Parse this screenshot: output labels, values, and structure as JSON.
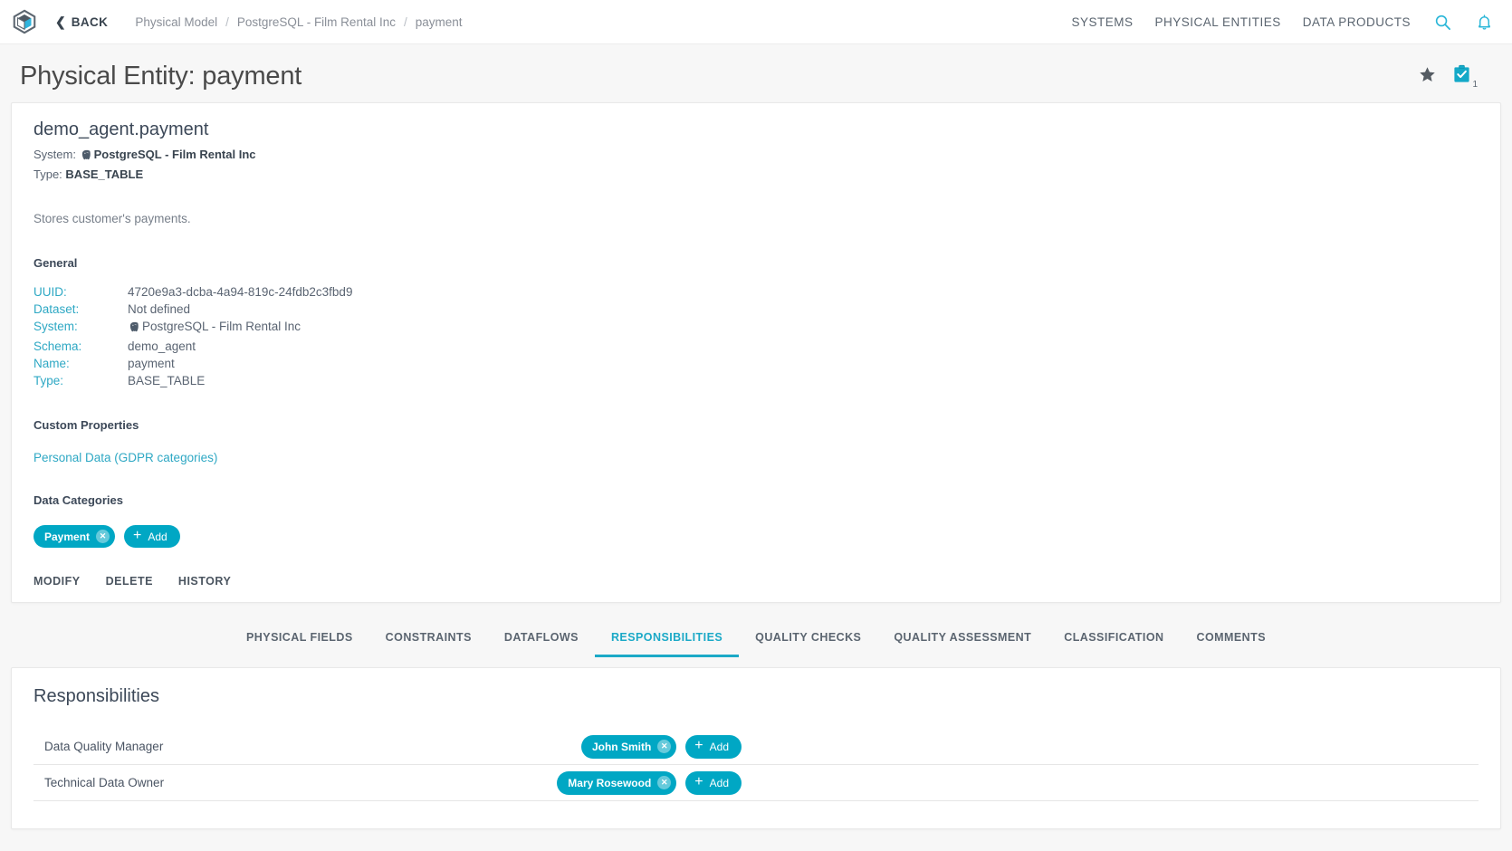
{
  "topbar": {
    "logo_icon": "cube-logo-icon",
    "back_label": "BACK",
    "back_chevron_icon": "chevron-left-icon",
    "breadcrumb": [
      {
        "label": "Physical Model",
        "last": false
      },
      {
        "label": "PostgreSQL - Film Rental Inc",
        "last": false
      },
      {
        "label": "payment",
        "last": true
      }
    ],
    "breadcrumb_separator": "/",
    "nav": [
      {
        "label": "SYSTEMS"
      },
      {
        "label": "PHYSICAL ENTITIES"
      },
      {
        "label": "DATA PRODUCTS"
      }
    ],
    "search_icon": "search-icon",
    "notifications_icon": "bell-icon"
  },
  "page": {
    "title": "Physical Entity: payment",
    "favorite_icon": "star-icon",
    "task_icon": "clipboard-check-icon",
    "task_count": "1"
  },
  "entity": {
    "name": "demo_agent.payment",
    "system_label": "System:",
    "system_value": "PostgreSQL - Film Rental Inc",
    "system_icon": "postgresql-elephant-icon",
    "type_label": "Type:",
    "type_value": "BASE_TABLE",
    "description": "Stores customer's payments."
  },
  "general": {
    "heading": "General",
    "rows": [
      {
        "key": "UUID:",
        "value": "4720e9a3-dcba-4a94-819c-24fdb2c3fbd9",
        "icon": ""
      },
      {
        "key": "Dataset:",
        "value": "Not defined",
        "icon": ""
      },
      {
        "key": "System:",
        "value": "PostgreSQL - Film Rental Inc",
        "icon": "postgresql-elephant-icon"
      },
      {
        "key": "Schema:",
        "value": "demo_agent",
        "icon": ""
      },
      {
        "key": "Name:",
        "value": "payment",
        "icon": ""
      },
      {
        "key": "Type:",
        "value": "BASE_TABLE",
        "icon": ""
      }
    ]
  },
  "custom_properties": {
    "heading": "Custom Properties",
    "link_label": "Personal Data (GDPR categories)"
  },
  "data_categories": {
    "heading": "Data Categories",
    "chips": [
      {
        "label": "Payment",
        "remove_icon": "close-circle-icon"
      }
    ],
    "add_label": "Add",
    "add_icon": "plus-icon"
  },
  "actions": [
    {
      "label": "MODIFY"
    },
    {
      "label": "DELETE"
    },
    {
      "label": "HISTORY"
    }
  ],
  "tabs": [
    {
      "label": "PHYSICAL FIELDS",
      "active": false
    },
    {
      "label": "CONSTRAINTS",
      "active": false
    },
    {
      "label": "DATAFLOWS",
      "active": false
    },
    {
      "label": "RESPONSIBILITIES",
      "active": true
    },
    {
      "label": "QUALITY CHECKS",
      "active": false
    },
    {
      "label": "QUALITY ASSESSMENT",
      "active": false
    },
    {
      "label": "CLASSIFICATION",
      "active": false
    },
    {
      "label": "COMMENTS",
      "active": false
    }
  ],
  "responsibilities": {
    "title": "Responsibilities",
    "add_label": "Add",
    "add_icon": "plus-icon",
    "rows": [
      {
        "role": "Data Quality Manager",
        "people": [
          {
            "name": "John Smith",
            "remove_icon": "close-circle-icon"
          }
        ]
      },
      {
        "role": "Technical Data Owner",
        "people": [
          {
            "name": "Mary Rosewood",
            "remove_icon": "close-circle-icon"
          }
        ]
      }
    ]
  },
  "colors": {
    "accent": "#00a7c4",
    "accent_text": "#2ea8c4",
    "tab_active": "#1ba9c7",
    "text_primary": "#3c4858",
    "text_muted": "#8a8f98",
    "page_bg": "#f7f7f7",
    "card_bg": "#ffffff"
  }
}
